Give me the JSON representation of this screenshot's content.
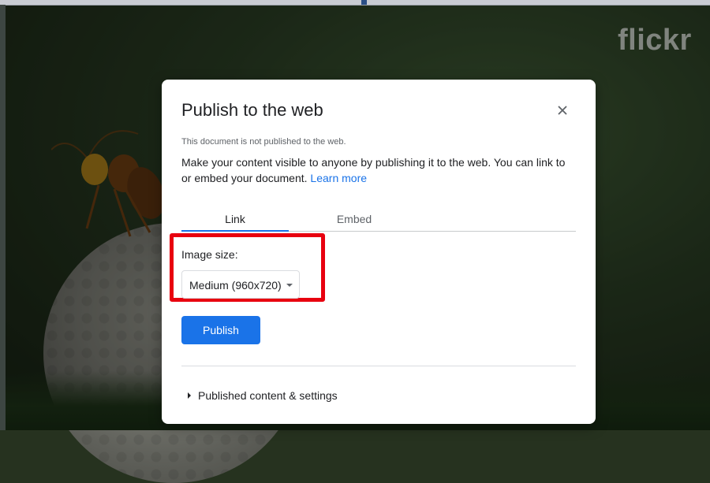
{
  "background": {
    "watermark": "flickr"
  },
  "dialog": {
    "title": "Publish to the web",
    "close_icon": "close-icon",
    "status": "This document is not published to the web.",
    "description": "Make your content visible to anyone by publishing it to the web. You can link to or embed your document.",
    "learn_more": "Learn more",
    "tabs": [
      {
        "label": "Link",
        "active": true
      },
      {
        "label": "Embed",
        "active": false
      }
    ],
    "image_size_label": "Image size:",
    "image_size_value": "Medium (960x720)",
    "publish_label": "Publish",
    "settings_label": "Published content & settings"
  },
  "colors": {
    "accent": "#1a73e8",
    "highlight": "#e8000f"
  }
}
